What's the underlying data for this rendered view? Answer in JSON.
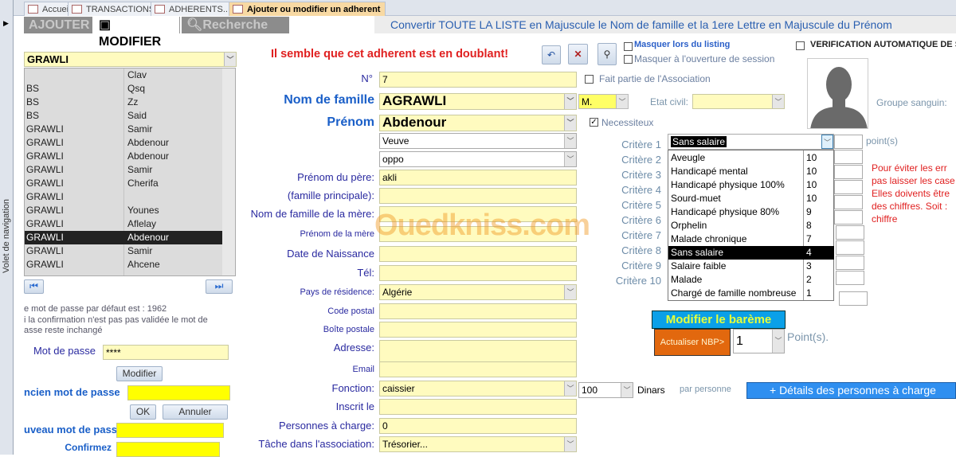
{
  "nav_pane": {
    "label": "Volet de navigation"
  },
  "doc_tabs": [
    {
      "label": "Accueil"
    },
    {
      "label": "TRANSACTIONS"
    },
    {
      "label": "ADHERENTS..."
    },
    {
      "label": "Ajouter ou modifier un adherent",
      "active": true
    }
  ],
  "form_tabs": [
    {
      "label": "AJOUTER"
    },
    {
      "label": "MODIFIER",
      "active": true
    },
    {
      "label": "Recherche"
    }
  ],
  "convert_link": "Convertir TOUTE LA LISTE en Majuscule le Nom de famille et la 1ere Lettre en Majuscule du Prénom",
  "search_combo": {
    "value": "GRAWLI"
  },
  "list": {
    "rows": [
      [
        "",
        "Clav"
      ],
      [
        "BS",
        "Qsq"
      ],
      [
        "BS",
        "Zz"
      ],
      [
        "BS",
        "Said"
      ],
      [
        "GRAWLI",
        "Samir"
      ],
      [
        "GRAWLI",
        "Abdenour"
      ],
      [
        "GRAWLI",
        "Abdenour"
      ],
      [
        "GRAWLI",
        "Samir"
      ],
      [
        "GRAWLI",
        "Cherifa"
      ],
      [
        "GRAWLI",
        ""
      ],
      [
        "GRAWLI",
        "Younes"
      ],
      [
        "GRAWLI",
        "Aflelay"
      ],
      [
        "GRAWLI",
        "Abdenour"
      ],
      [
        "GRAWLI",
        "Samir"
      ],
      [
        "GRAWLI",
        "Ahcene"
      ]
    ],
    "selected_index": 12
  },
  "password": {
    "note1": "e mot de passe par défaut est : 1962",
    "note2": "i la confirmation n'est pas pas validée le mot de",
    "note3": "asse reste inchangé",
    "label": "Mot de passe",
    "value": "****",
    "modify": "Modifier",
    "old_label": "ncien  mot de passe",
    "ok": "OK",
    "cancel": "Annuler",
    "new_label": "uveau mot de passe",
    "confirm_label": "Confirmez"
  },
  "warning": "Il semble que cet adherent est en doublant!",
  "checks": {
    "hide_listing": "Masquer  lors du listing",
    "hide_session": "Masquer à l'ouverture de session",
    "auto_verif": "VERIFICATION AUTOMATIQUE DE SA",
    "member": "Fait partie de l'Association",
    "needy": "Necessiteux",
    "needy_checked": true
  },
  "fields": {
    "num": {
      "label": "N°",
      "value": "7"
    },
    "nom": {
      "label": "Nom de famille",
      "value": "AGRAWLI"
    },
    "civilite": {
      "value": "M."
    },
    "etat_civil": {
      "label": "Etat civil:",
      "value": ""
    },
    "prenom": {
      "label": "Prénom",
      "value": "Abdenour"
    },
    "situation": {
      "value": "Veuve"
    },
    "oppo": {
      "value": "oppo"
    },
    "prenom_pere": {
      "label": "Prénom du père:",
      "value": "akli"
    },
    "famille_principale": {
      "label": "(famille principale):",
      "value": ""
    },
    "nom_mere": {
      "label": "Nom de famille de la mère:",
      "value": ""
    },
    "prenom_mere": {
      "label": "Prénom de la mère",
      "value": ""
    },
    "naissance": {
      "label": "Date de Naissance",
      "value": ""
    },
    "tel": {
      "label": "Tél:",
      "value": ""
    },
    "pays": {
      "label": "Pays de résidence:",
      "value": "Algérie"
    },
    "code_postal": {
      "label": "Code postal",
      "value": ""
    },
    "boite_postale": {
      "label": "Boîte postale",
      "value": ""
    },
    "adresse": {
      "label": "Adresse:",
      "value": ""
    },
    "email": {
      "label": "Email",
      "value": ""
    },
    "fonction": {
      "label": "Fonction:",
      "value": "caissier"
    },
    "montant": {
      "value": "100",
      "unit": "Dinars",
      "per": "par personne"
    },
    "inscrit": {
      "label": "Inscrit le",
      "value": ""
    },
    "personnes": {
      "label": "Personnes à charge:",
      "value": "0"
    },
    "tache": {
      "label": "Tâche dans l'association:",
      "value": "Trésorier..."
    }
  },
  "blood_label": "Groupe sanguin:",
  "criteria": {
    "labels": [
      "Critère 1",
      "Critère 2",
      "Critère 3",
      "Critère 4",
      "Critère 5",
      "Critère 6",
      "Critère 7",
      "Critère 8",
      "Critère 9",
      "Critère 10"
    ],
    "selected": "Sans salaire",
    "points_label": "point(s)",
    "options": [
      [
        "Aveugle",
        "10"
      ],
      [
        "Handicapé mental",
        "10"
      ],
      [
        "Handicapé physique 100%",
        "10"
      ],
      [
        "Sourd-muet",
        "10"
      ],
      [
        "Handicapé physique 80%",
        "9"
      ],
      [
        "Orphelin",
        "8"
      ],
      [
        "Malade chronique",
        "7"
      ],
      [
        "Sans salaire",
        "4"
      ],
      [
        "Salaire faible",
        "3"
      ],
      [
        "Malade",
        "2"
      ],
      [
        "Chargé de famille nombreuse",
        "1"
      ]
    ],
    "selected_index": 7
  },
  "hint": [
    "Pour éviter les err",
    "pas laisser les case",
    "Elles doivents être",
    "des chiffres.  Soit :",
    "chiffre"
  ],
  "bareme": "Modifier le barème",
  "actualiser": "Actualiser NBP>",
  "nbp": {
    "value": "1",
    "unit": "Point(s)."
  },
  "details_btn": "+ Détails des personnes à charge",
  "watermark": "Ouedkniss.com"
}
